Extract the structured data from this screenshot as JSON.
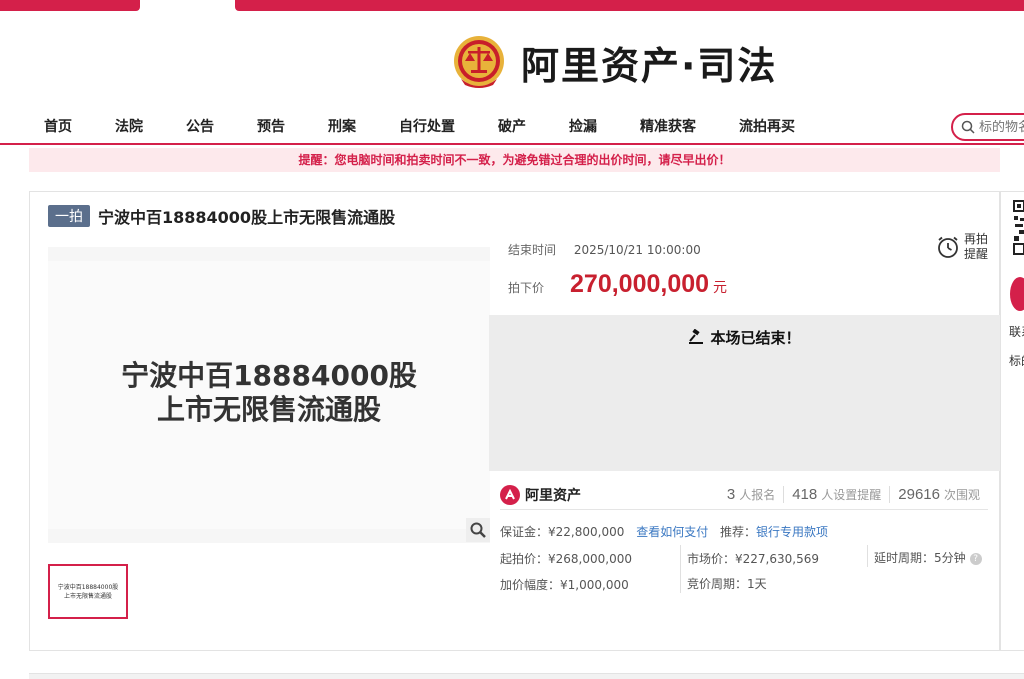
{
  "header": {
    "logo_text": "阿里资产·司法"
  },
  "nav": {
    "items": [
      "首页",
      "法院",
      "公告",
      "预告",
      "刑案",
      "自行处置",
      "破产",
      "捡漏",
      "精准获客",
      "流拍再买"
    ],
    "search_placeholder": "标的物名"
  },
  "notice": "提醒：您电脑时间和拍卖时间不一致，为避免错过合理的出价时间，请尽早出价！",
  "item": {
    "tag": "一拍",
    "title": "宁波中百18884000股上市无限售流通股",
    "image_caption_line1": "宁波中百18884000股",
    "image_caption_line2": "上市无限售流通股",
    "thumb_line1": "宁波中百18884000股",
    "thumb_line2": "上市无限售流通股"
  },
  "auction": {
    "end_label": "结束时间",
    "end_value": "2025/10/21 10:00:00",
    "price_label": "拍下价",
    "price_value": "270,000,000",
    "price_unit": "元",
    "remind_line1": "再拍",
    "remind_line2": "提醒",
    "ended_text": "本场已结束！"
  },
  "stats": {
    "brand": "阿里资产",
    "signups": "3",
    "signups_label": "人报名",
    "reminders": "418",
    "reminders_label": "人设置提醒",
    "views": "29616",
    "views_label": "次围观"
  },
  "details": {
    "deposit_label": "保证金：",
    "deposit_value": "¥22,800,000",
    "pay_link": "查看如何支付",
    "recommend_label": "推荐：",
    "recommend_link": "银行专用款项",
    "start_label": "起拍价：",
    "start_value": "¥268,000,000",
    "market_label": "市场价：",
    "market_value": "¥227,630,569",
    "delay_label": "延时周期：",
    "delay_value": "5分钟",
    "increment_label": "加价幅度：",
    "increment_value": "¥1,000,000",
    "bid_period_label": "竞价周期：",
    "bid_period_value": "1天"
  },
  "right_panel": {
    "text1": "联系",
    "text2": "标的"
  },
  "colors": {
    "brand_red": "#d4204a",
    "price_red": "#c8202f",
    "link_blue": "#3b78c2",
    "tag_gray": "#5b6f8c"
  }
}
